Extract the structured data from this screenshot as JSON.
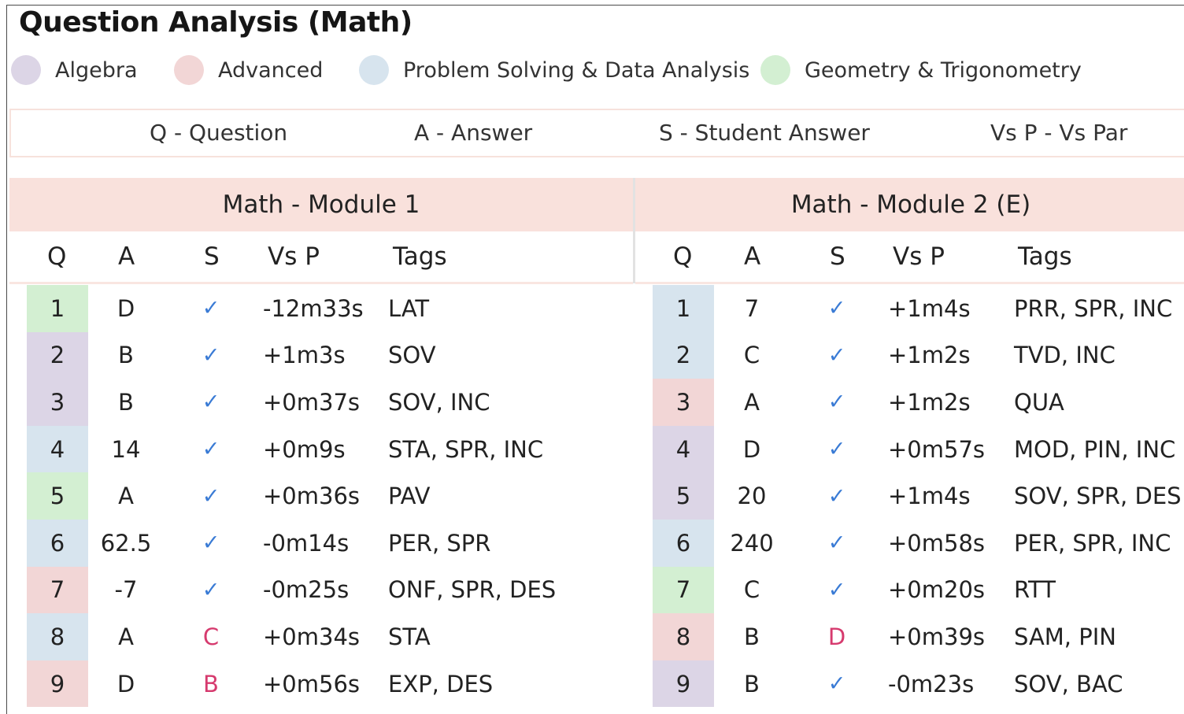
{
  "title": "Question Analysis (Math)",
  "legend": [
    {
      "label": "Algebra",
      "color": "#dcd5e6"
    },
    {
      "label": "Advanced",
      "color": "#f2d6d6"
    },
    {
      "label": "Problem Solving & Data Analysis",
      "color": "#d7e4ee"
    },
    {
      "label": "Geometry & Trigonometry",
      "color": "#d3efd2"
    }
  ],
  "key": [
    "Q - Question",
    "A - Answer",
    "S - Student Answer",
    "Vs P - Vs Par"
  ],
  "columns": [
    "Q",
    "A",
    "S",
    "Vs P",
    "Tags"
  ],
  "modules": [
    {
      "title": "Math - Module 1",
      "rows": [
        {
          "q": "1",
          "a": "D",
          "s": "✓",
          "correct": true,
          "vsp": "-12m33s",
          "tags": "LAT",
          "category": "Geometry & Trigonometry"
        },
        {
          "q": "2",
          "a": "B",
          "s": "✓",
          "correct": true,
          "vsp": "+1m3s",
          "tags": "SOV",
          "category": "Algebra"
        },
        {
          "q": "3",
          "a": "B",
          "s": "✓",
          "correct": true,
          "vsp": "+0m37s",
          "tags": "SOV, INC",
          "category": "Algebra"
        },
        {
          "q": "4",
          "a": "14",
          "s": "✓",
          "correct": true,
          "vsp": "+0m9s",
          "tags": "STA, SPR, INC",
          "category": "Problem Solving & Data Analysis"
        },
        {
          "q": "5",
          "a": "A",
          "s": "✓",
          "correct": true,
          "vsp": "+0m36s",
          "tags": "PAV",
          "category": "Geometry & Trigonometry"
        },
        {
          "q": "6",
          "a": "62.5",
          "s": "✓",
          "correct": true,
          "vsp": "-0m14s",
          "tags": "PER, SPR",
          "category": "Problem Solving & Data Analysis"
        },
        {
          "q": "7",
          "a": "-7",
          "s": "✓",
          "correct": true,
          "vsp": "-0m25s",
          "tags": "ONF, SPR, DES",
          "category": "Advanced"
        },
        {
          "q": "8",
          "a": "A",
          "s": "C",
          "correct": false,
          "vsp": "+0m34s",
          "tags": "STA",
          "category": "Problem Solving & Data Analysis"
        },
        {
          "q": "9",
          "a": "D",
          "s": "B",
          "correct": false,
          "vsp": "+0m56s",
          "tags": "EXP, DES",
          "category": "Advanced"
        }
      ]
    },
    {
      "title": "Math - Module 2 (E)",
      "rows": [
        {
          "q": "1",
          "a": "7",
          "s": "✓",
          "correct": true,
          "vsp": "+1m4s",
          "tags": "PRR, SPR, INC",
          "category": "Problem Solving & Data Analysis"
        },
        {
          "q": "2",
          "a": "C",
          "s": "✓",
          "correct": true,
          "vsp": "+1m2s",
          "tags": "TVD, INC",
          "category": "Problem Solving & Data Analysis"
        },
        {
          "q": "3",
          "a": "A",
          "s": "✓",
          "correct": true,
          "vsp": "+1m2s",
          "tags": "QUA",
          "category": "Advanced"
        },
        {
          "q": "4",
          "a": "D",
          "s": "✓",
          "correct": true,
          "vsp": "+0m57s",
          "tags": "MOD, PIN, INC",
          "category": "Algebra"
        },
        {
          "q": "5",
          "a": "20",
          "s": "✓",
          "correct": true,
          "vsp": "+1m4s",
          "tags": "SOV, SPR, DES",
          "category": "Algebra"
        },
        {
          "q": "6",
          "a": "240",
          "s": "✓",
          "correct": true,
          "vsp": "+0m58s",
          "tags": "PER, SPR, INC",
          "category": "Problem Solving & Data Analysis"
        },
        {
          "q": "7",
          "a": "C",
          "s": "✓",
          "correct": true,
          "vsp": "+0m20s",
          "tags": "RTT",
          "category": "Geometry & Trigonometry"
        },
        {
          "q": "8",
          "a": "B",
          "s": "D",
          "correct": false,
          "vsp": "+0m39s",
          "tags": "SAM, PIN",
          "category": "Advanced"
        },
        {
          "q": "9",
          "a": "B",
          "s": "✓",
          "correct": true,
          "vsp": "-0m23s",
          "tags": "SOV, BAC",
          "category": "Algebra"
        }
      ]
    }
  ]
}
